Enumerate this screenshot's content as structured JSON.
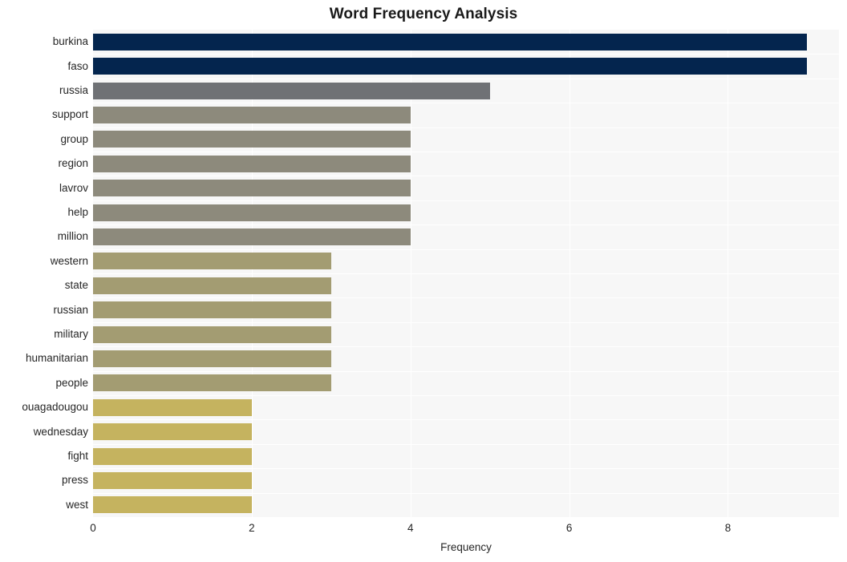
{
  "chart_data": {
    "type": "bar",
    "orientation": "horizontal",
    "title": "Word Frequency Analysis",
    "xlabel": "Frequency",
    "ylabel": "",
    "categories": [
      "burkina",
      "faso",
      "russia",
      "support",
      "group",
      "region",
      "lavrov",
      "help",
      "million",
      "western",
      "state",
      "russian",
      "military",
      "humanitarian",
      "people",
      "ouagadougou",
      "wednesday",
      "fight",
      "press",
      "west"
    ],
    "values": [
      9,
      9,
      5,
      4,
      4,
      4,
      4,
      4,
      4,
      3,
      3,
      3,
      3,
      3,
      3,
      2,
      2,
      2,
      2,
      2
    ],
    "bar_colors": [
      "#04254e",
      "#04254e",
      "#6f7175",
      "#8d8a7c",
      "#8d8a7c",
      "#8d8a7c",
      "#8d8a7c",
      "#8d8a7c",
      "#8d8a7c",
      "#a39c72",
      "#a39c72",
      "#a39c72",
      "#a39c72",
      "#a39c72",
      "#a39c72",
      "#c5b35f",
      "#c5b35f",
      "#c5b35f",
      "#c5b35f",
      "#c5b35f"
    ],
    "xlim": [
      0,
      9.4
    ],
    "xticks": [
      0,
      2,
      4,
      6,
      8
    ],
    "xtick_labels": [
      "0",
      "2",
      "4",
      "6",
      "8"
    ],
    "grid": true,
    "grid_color": "#ffffff",
    "plot_background": "#f7f7f7",
    "figure_background": "#ffffff",
    "legend": null
  }
}
